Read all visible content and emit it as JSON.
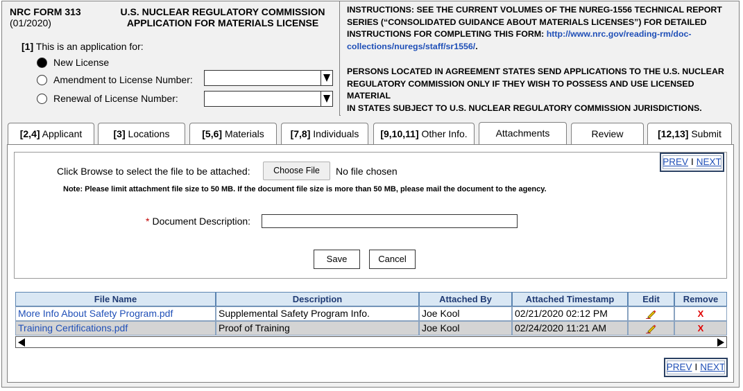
{
  "header": {
    "form_number": "NRC FORM 313",
    "form_date": "(01/2020)",
    "agency_line1": "U.S. NUCLEAR REGULATORY COMMISSION",
    "agency_line2": "APPLICATION FOR MATERIALS LICENSE",
    "question_number": "[1]",
    "question_text": "This is an application for:",
    "options": [
      {
        "label": "New License",
        "selected": true
      },
      {
        "label": "Amendment to License Number:",
        "selected": false
      },
      {
        "label": "Renewal of License Number:",
        "selected": false
      }
    ],
    "instructions_line1": "INSTRUCTIONS: SEE THE CURRENT VOLUMES OF THE NUREG-1556 TECHNICAL REPORT",
    "instructions_line2": "SERIES (“CONSOLIDATED GUIDANCE ABOUT MATERIALS LICENSES”) FOR DETAILED",
    "instructions_line3_text": "INSTRUCTIONS FOR COMPLETING THIS FORM: ",
    "instructions_link_part1": "http://www.nrc.gov/reading-rm/doc-",
    "instructions_link_part2": "collections/nuregs/staff/sr1556/",
    "instructions_line4_tail": ".",
    "agreement_line1": "PERSONS LOCATED IN AGREEMENT STATES SEND APPLICATIONS TO THE U.S. NUCLEAR",
    "agreement_line2": "REGULATORY COMMISSION ONLY IF THEY WISH TO POSSESS AND USE LICENSED MATERIAL",
    "agreement_line3": "IN STATES SUBJECT TO U.S. NUCLEAR REGULATORY COMMISSION JURISDICTIONS."
  },
  "tabs": [
    {
      "num": "[2,4]",
      "label": "Applicant"
    },
    {
      "num": "[3]",
      "label": "Locations"
    },
    {
      "num": "[5,6]",
      "label": "Materials"
    },
    {
      "num": "[7,8]",
      "label": "Individuals"
    },
    {
      "num": "[9,10,11]",
      "label": "Other Info."
    },
    {
      "num": "",
      "label": "Attachments",
      "active": true
    },
    {
      "num": "",
      "label": "Review"
    },
    {
      "num": "[12,13]",
      "label": "Submit"
    }
  ],
  "attach": {
    "browse_label": "Click Browse to select the file to be attached:",
    "choose_file": "Choose File",
    "no_file": "No file chosen",
    "note": "Note: Please limit attachment file size to 50 MB. If the document file size is more than 50 MB, please mail the document to the agency.",
    "required_mark": "*",
    "desc_label": "Document Description:",
    "desc_value": "",
    "save": "Save",
    "cancel": "Cancel"
  },
  "nav": {
    "prev": "PREV",
    "sep": "I",
    "next": "NEXT"
  },
  "table": {
    "headers": [
      "File Name",
      "Description",
      "Attached By",
      "Attached Timestamp",
      "Edit",
      "Remove"
    ],
    "rows": [
      {
        "file": "More Info About Safety Program.pdf",
        "description": "Supplemental Safety Program Info.",
        "by": "Joe Kool",
        "timestamp": "02/21/2020 02:12 PM",
        "remove": "X"
      },
      {
        "file": "Training Certifications.pdf",
        "description": "Proof of Training",
        "by": "Joe Kool",
        "timestamp": "02/24/2020 11:21 AM",
        "remove": "X"
      }
    ]
  },
  "colors": {
    "link": "#1f4fb7",
    "header_bg": "#d9e7f4",
    "remove_x": "#e00000",
    "required": "#c00000"
  }
}
